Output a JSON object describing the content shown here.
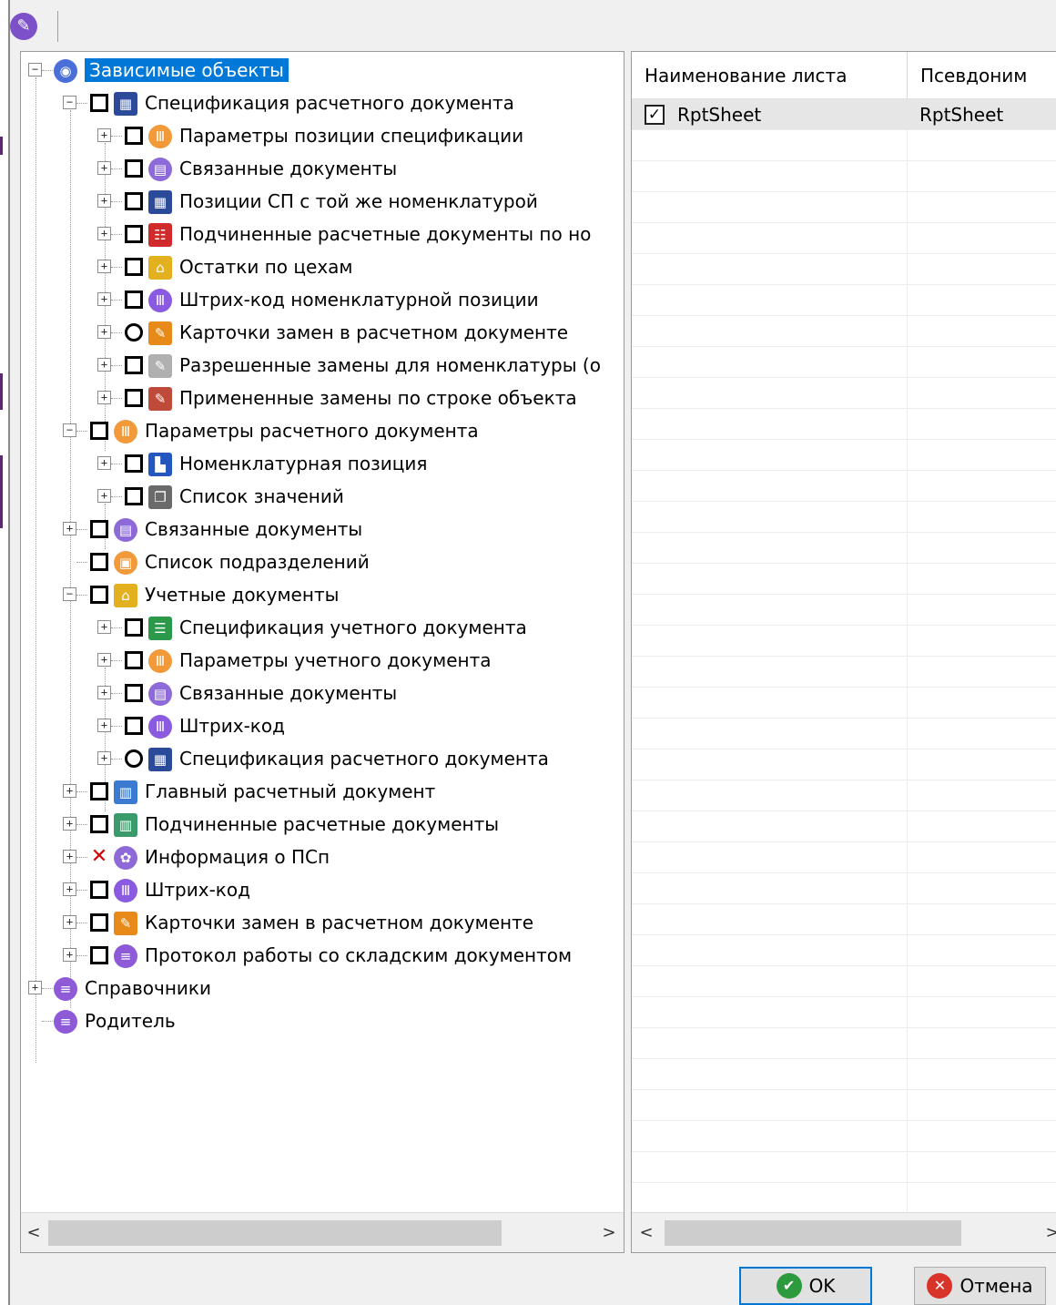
{
  "toolbar": {
    "edit_icon": "pencil-icon"
  },
  "tree": {
    "rows": [
      {
        "label": "Зависимые объекты",
        "level": 0,
        "expander": "−",
        "check": "none",
        "icon": "globe-icon",
        "icon_color": "#4a6fd8",
        "icon_glyph": "◉",
        "selected": true
      },
      {
        "label": "Спецификация расчетного документа",
        "level": 1,
        "expander": "−",
        "check": "empty",
        "icon": "spec-table-icon",
        "icon_color": "#2b4a9a",
        "icon_glyph": "▦"
      },
      {
        "label": "Параметры позиции спецификации",
        "level": 2,
        "expander": "+",
        "check": "empty",
        "icon": "params-icon",
        "icon_color": "#f29a3a",
        "icon_glyph": "Ⅲ"
      },
      {
        "label": "Связанные документы",
        "level": 2,
        "expander": "+",
        "check": "empty",
        "icon": "linked-docs-icon",
        "icon_color": "#8e6ad8",
        "icon_glyph": "▤"
      },
      {
        "label": "Позиции СП с той же номенклатурой",
        "level": 2,
        "expander": "+",
        "check": "empty",
        "icon": "spec-table-icon",
        "icon_color": "#2b4a9a",
        "icon_glyph": "▦"
      },
      {
        "label": "Подчиненные расчетные документы по но",
        "level": 2,
        "expander": "+",
        "check": "empty",
        "icon": "sub-docs-icon",
        "icon_color": "#d02a2a",
        "icon_glyph": "☷"
      },
      {
        "label": "Остатки по цехам",
        "level": 2,
        "expander": "+",
        "check": "empty",
        "icon": "warehouse-icon",
        "icon_color": "#e3b020",
        "icon_glyph": "⌂"
      },
      {
        "label": "Штрих-код номенклатурной позиции",
        "level": 2,
        "expander": "+",
        "check": "empty",
        "icon": "barcode-icon",
        "icon_color": "#8a5ae0",
        "icon_glyph": "Ⅲ"
      },
      {
        "label": "Карточки замен в расчетном документе",
        "level": 2,
        "expander": "+",
        "check": "partial",
        "icon": "replace-card-icon",
        "icon_color": "#e88a1a",
        "icon_glyph": "✎"
      },
      {
        "label": "Разрешенные замены для номенклатуры (о",
        "level": 2,
        "expander": "+",
        "check": "empty",
        "icon": "allowed-replace-icon",
        "icon_color": "#b0b0b0",
        "icon_glyph": "✎"
      },
      {
        "label": "Примененные замены по строке объекта",
        "level": 2,
        "expander": "+",
        "check": "empty",
        "icon": "applied-replace-icon",
        "icon_color": "#c04a3a",
        "icon_glyph": "✎"
      },
      {
        "label": "Параметры расчетного документа",
        "level": 1,
        "expander": "−",
        "check": "empty",
        "icon": "params-icon",
        "icon_color": "#f29a3a",
        "icon_glyph": "Ⅲ"
      },
      {
        "label": "Номенклатурная позиция",
        "level": 2,
        "expander": "+",
        "check": "empty",
        "icon": "nomenclature-icon",
        "icon_color": "#2456c0",
        "icon_glyph": "▙"
      },
      {
        "label": "Список значений",
        "level": 2,
        "expander": "+",
        "check": "empty",
        "icon": "values-list-icon",
        "icon_color": "#6a6a6a",
        "icon_glyph": "❐"
      },
      {
        "label": "Связанные документы",
        "level": 1,
        "expander": "+",
        "check": "empty",
        "icon": "linked-docs-icon",
        "icon_color": "#8e6ad8",
        "icon_glyph": "▤"
      },
      {
        "label": "Список подразделений",
        "level": 1,
        "expander": "",
        "check": "empty",
        "icon": "departments-icon",
        "icon_color": "#f29a3a",
        "icon_glyph": "▣"
      },
      {
        "label": "Учетные документы",
        "level": 1,
        "expander": "−",
        "check": "empty",
        "icon": "accounting-docs-icon",
        "icon_color": "#e3b020",
        "icon_glyph": "⌂"
      },
      {
        "label": "Спецификация учетного документа",
        "level": 2,
        "expander": "+",
        "check": "empty",
        "icon": "acc-spec-icon",
        "icon_color": "#2a9a4a",
        "icon_glyph": "☰"
      },
      {
        "label": "Параметры учетного документа",
        "level": 2,
        "expander": "+",
        "check": "empty",
        "icon": "params-icon",
        "icon_color": "#f29a3a",
        "icon_glyph": "Ⅲ"
      },
      {
        "label": "Связанные документы",
        "level": 2,
        "expander": "+",
        "check": "empty",
        "icon": "linked-docs-icon",
        "icon_color": "#8e6ad8",
        "icon_glyph": "▤"
      },
      {
        "label": "Штрих-код",
        "level": 2,
        "expander": "+",
        "check": "empty",
        "icon": "barcode-icon",
        "icon_color": "#8a5ae0",
        "icon_glyph": "Ⅲ"
      },
      {
        "label": "Спецификация расчетного документа",
        "level": 2,
        "expander": "+",
        "check": "partial",
        "icon": "spec-table-icon",
        "icon_color": "#2b4a9a",
        "icon_glyph": "▦"
      },
      {
        "label": "Главный расчетный документ",
        "level": 1,
        "expander": "+",
        "check": "empty",
        "icon": "main-doc-icon",
        "icon_color": "#3a7ad0",
        "icon_glyph": "▥"
      },
      {
        "label": "Подчиненные расчетные документы",
        "level": 1,
        "expander": "+",
        "check": "empty",
        "icon": "sub-docs-icon",
        "icon_color": "#3a9a6a",
        "icon_glyph": "▥"
      },
      {
        "label": "Информация о ПСп",
        "level": 1,
        "expander": "+",
        "check": "excluded",
        "icon": "info-icon",
        "icon_color": "#8e6ad8",
        "icon_glyph": "✿"
      },
      {
        "label": "Штрих-код",
        "level": 1,
        "expander": "+",
        "check": "empty",
        "icon": "barcode-icon",
        "icon_color": "#8a5ae0",
        "icon_glyph": "Ⅲ"
      },
      {
        "label": "Карточки замен в расчетном документе",
        "level": 1,
        "expander": "+",
        "check": "empty",
        "icon": "replace-card-icon",
        "icon_color": "#e88a1a",
        "icon_glyph": "✎"
      },
      {
        "label": "Протокол работы со складским документом",
        "level": 1,
        "expander": "+",
        "check": "empty",
        "icon": "protocol-icon",
        "icon_color": "#8e5ad8",
        "icon_glyph": "≡"
      },
      {
        "label": "Справочники",
        "level": 0,
        "expander": "+",
        "check": "none",
        "icon": "directories-icon",
        "icon_color": "#8e5ad8",
        "icon_glyph": "≡"
      },
      {
        "label": "Родитель",
        "level": 0,
        "expander": "",
        "check": "none",
        "icon": "parent-icon",
        "icon_color": "#8e5ad8",
        "icon_glyph": "≡"
      }
    ]
  },
  "grid": {
    "columns": [
      "Наименование листа",
      "Псевдоним"
    ],
    "rows": [
      {
        "checked": true,
        "name": "RptSheet",
        "alias": "RptSheet"
      }
    ]
  },
  "buttons": {
    "ok_label": "OK",
    "cancel_label": "Отмена",
    "ok_icon": "check-icon",
    "cancel_icon": "close-icon",
    "ok_color": "#2e9a3e",
    "cancel_color": "#d8342a"
  }
}
